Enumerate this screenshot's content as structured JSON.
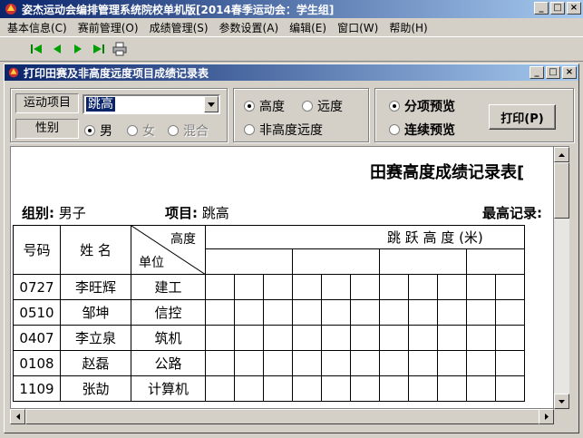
{
  "window": {
    "title": "姿杰运动会编排管理系统院校单机版[2014春季运动会：学生组]"
  },
  "menu": [
    "基本信息(C)",
    "赛前管理(O)",
    "成绩管理(S)",
    "参数设置(A)",
    "编辑(E)",
    "窗口(W)",
    "帮助(H)"
  ],
  "toolbar": {
    "icons": [
      "first-record-icon",
      "prev-record-icon",
      "next-record-icon",
      "last-record-icon",
      "print-icon"
    ]
  },
  "child": {
    "title": "打印田赛及非高度远度项目成绩记录表",
    "event_label": "运动项目",
    "event_value": "跳高",
    "gender_label": "性别",
    "gender_options": [
      "男",
      "女",
      "混合"
    ],
    "gender_selected": "男",
    "type_options": [
      "高度",
      "远度",
      "非高度远度"
    ],
    "type_selected": "高度",
    "preview_options": [
      "分项预览",
      "连续预览"
    ],
    "preview_selected": "分项预览",
    "print_label": "打印(P)"
  },
  "report": {
    "title": "田赛高度成绩记录表[",
    "group_label": "组别:",
    "group_value": "男子",
    "event_label": "项目:",
    "event_value": "跳高",
    "record_label": "最高记录:",
    "col_no": "号码",
    "col_name": "姓  名",
    "col_height": "高度",
    "col_unit": "单位",
    "jump_header": "跳    跃    高    度    (米)",
    "rows": [
      {
        "no": "0727",
        "name": "李旺辉",
        "unit": "建工"
      },
      {
        "no": "0510",
        "name": "邹坤",
        "unit": "信控"
      },
      {
        "no": "0407",
        "name": "李立泉",
        "unit": "筑机"
      },
      {
        "no": "0108",
        "name": "赵磊",
        "unit": "公路"
      },
      {
        "no": "1109",
        "name": "张劼",
        "unit": "计算机"
      }
    ]
  }
}
